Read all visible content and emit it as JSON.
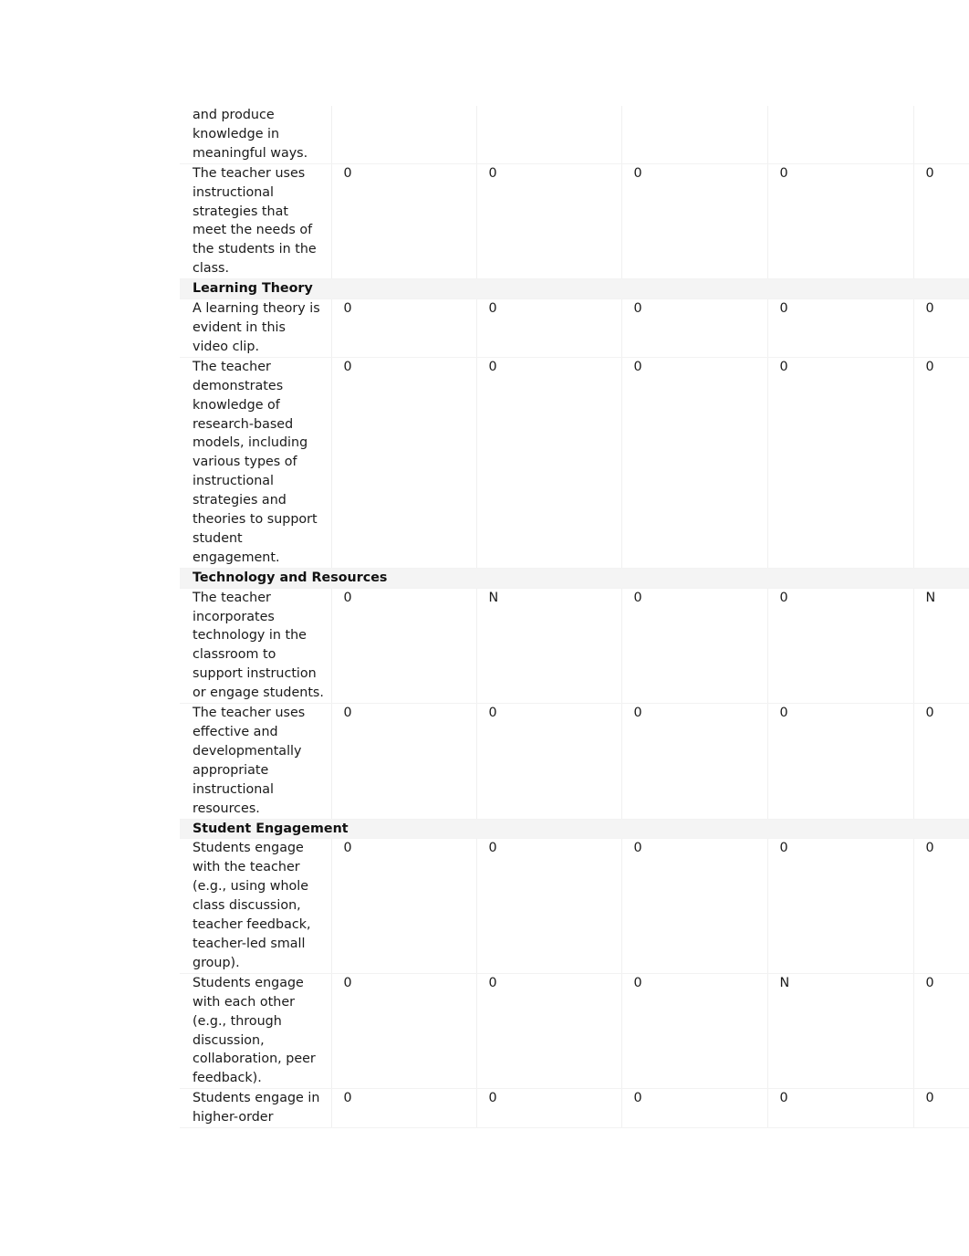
{
  "document": {
    "type": "rubric-evaluation-table",
    "columns": [
      {
        "key": "criteria",
        "label": ""
      },
      {
        "key": "rater1",
        "label": ""
      },
      {
        "key": "rater2",
        "label": ""
      },
      {
        "key": "rater3",
        "label": ""
      },
      {
        "key": "rater4",
        "label": ""
      },
      {
        "key": "rater5",
        "label": ""
      }
    ],
    "rows": [
      {
        "kind": "criteria",
        "continued": true,
        "criteria": "and produce knowledge in meaningful ways.",
        "values": [
          "",
          "",
          "",
          "",
          ""
        ]
      },
      {
        "kind": "criteria",
        "criteria": "The teacher uses instructional strategies that meet the needs of the students in the class.",
        "values": [
          "0",
          "0",
          "0",
          "0",
          "0"
        ]
      },
      {
        "kind": "section",
        "criteria": "Learning Theory",
        "values": [
          "",
          "",
          "",
          "",
          ""
        ]
      },
      {
        "kind": "criteria",
        "criteria": "A learning theory is evident in this video clip.",
        "values": [
          "0",
          "0",
          "0",
          "0",
          "0"
        ]
      },
      {
        "kind": "criteria",
        "criteria": "The teacher demonstrates knowledge of research-based models, including various types of instructional strategies and theories to support student engagement.",
        "values": [
          "0",
          "0",
          "0",
          "0",
          "0"
        ]
      },
      {
        "kind": "section",
        "criteria": "Technology and Resources",
        "values": [
          "",
          "",
          "",
          "",
          ""
        ]
      },
      {
        "kind": "criteria",
        "criteria": "The teacher incorporates technology in the classroom to support instruction or engage students.",
        "values": [
          "0",
          "N",
          "0",
          "0",
          "N"
        ]
      },
      {
        "kind": "criteria",
        "criteria": "The teacher uses effective and developmentally appropriate instructional resources.",
        "values": [
          "0",
          "0",
          "0",
          "0",
          "0"
        ]
      },
      {
        "kind": "section",
        "criteria": "Student Engagement",
        "values": [
          "",
          "",
          "",
          "",
          ""
        ]
      },
      {
        "kind": "criteria",
        "criteria": "Students engage with the teacher (e.g., using whole class discussion, teacher feedback, teacher-led small group).",
        "values": [
          "0",
          "0",
          "0",
          "0",
          "0"
        ]
      },
      {
        "kind": "criteria",
        "criteria": "Students engage with each other (e.g., through discussion, collaboration, peer feedback).",
        "values": [
          "0",
          "0",
          "0",
          "N",
          "0"
        ]
      },
      {
        "kind": "criteria",
        "clipped": true,
        "criteria": "Students engage in higher-order",
        "values": [
          "0",
          "0",
          "0",
          "0",
          "0"
        ]
      }
    ]
  },
  "style": {
    "text_color": "#1a1a1a",
    "section_band": "#f4f4f4",
    "row_shade": "#fbfbfb",
    "grid_line": "#f0f0f0",
    "page_background": "#ffffff"
  }
}
